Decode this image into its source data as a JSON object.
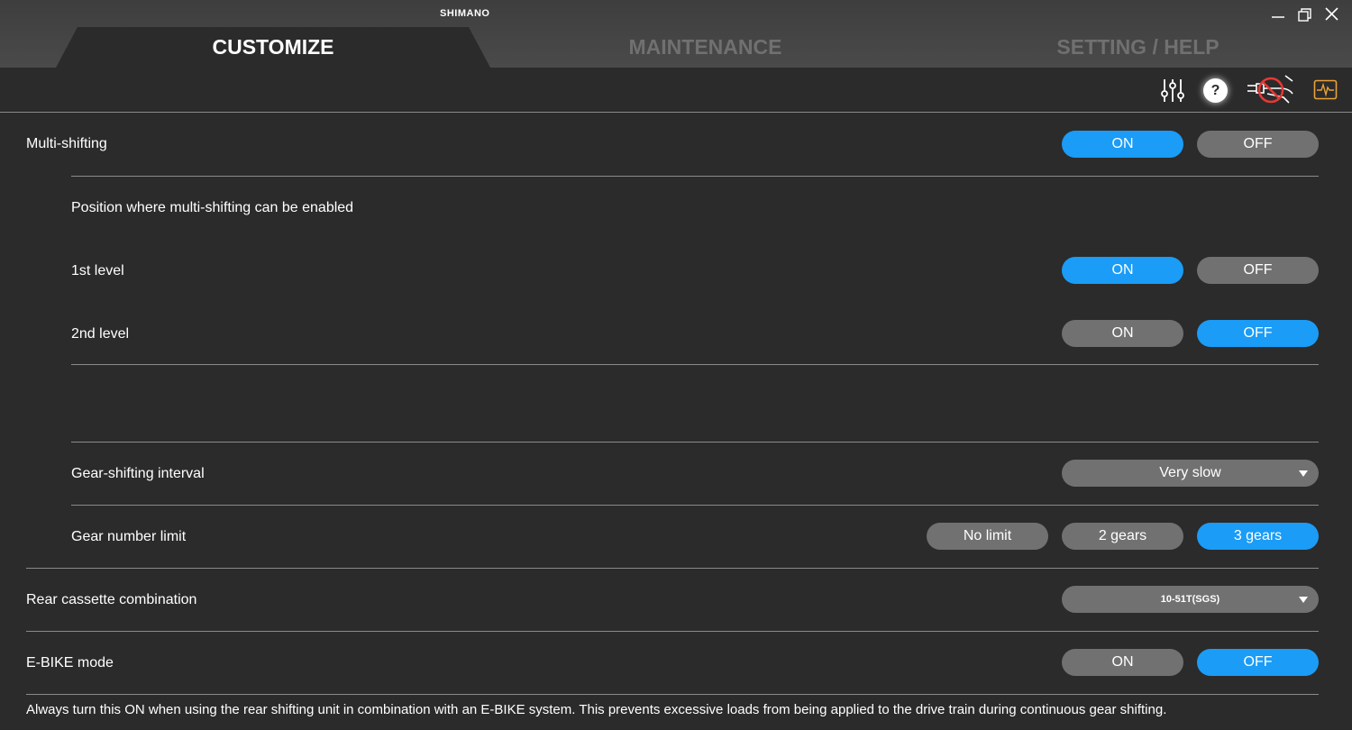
{
  "app": {
    "brand": "SHIMANO",
    "window_controls": [
      "minimize-icon",
      "restore-icon",
      "close-icon"
    ]
  },
  "tabs": [
    {
      "label": "CUSTOMIZE",
      "active": true
    },
    {
      "label": "MAINTENANCE",
      "active": false
    },
    {
      "label": "SETTING / HELP",
      "active": false
    }
  ],
  "toolbar": {
    "icons": [
      "adjust-sliders-icon",
      "help-icon",
      "bike-disconnected-icon",
      "waveform-monitor-icon"
    ],
    "help_glyph": "?"
  },
  "settings": {
    "multi_shifting": {
      "label": "Multi-shifting",
      "on": "ON",
      "off": "OFF",
      "selected": "ON"
    },
    "position_heading": "Position where multi-shifting can be enabled",
    "level1": {
      "label": "1st level",
      "on": "ON",
      "off": "OFF",
      "selected": "ON"
    },
    "level2": {
      "label": "2nd level",
      "on": "ON",
      "off": "OFF",
      "selected": "OFF"
    },
    "gear_interval": {
      "label": "Gear-shifting interval",
      "value": "Very slow"
    },
    "gear_limit": {
      "label": "Gear number limit",
      "options": [
        "No limit",
        "2 gears",
        "3 gears"
      ],
      "selected": "3 gears"
    },
    "rear_cassette": {
      "label": "Rear cassette combination",
      "value": "10-51T(SGS)"
    },
    "ebike_mode": {
      "label": "E-BIKE mode",
      "on": "ON",
      "off": "OFF",
      "selected": "OFF"
    },
    "note": "Always turn this ON when using the rear shifting unit in combination with an E-BIKE system. This prevents excessive loads from being applied to the drive train during continuous gear shifting."
  },
  "colors": {
    "accent": "#1a9cf7",
    "button_off": "#717171",
    "background": "#2b2b2b",
    "warning": "#e8a33a",
    "prohibit": "#e53935"
  }
}
